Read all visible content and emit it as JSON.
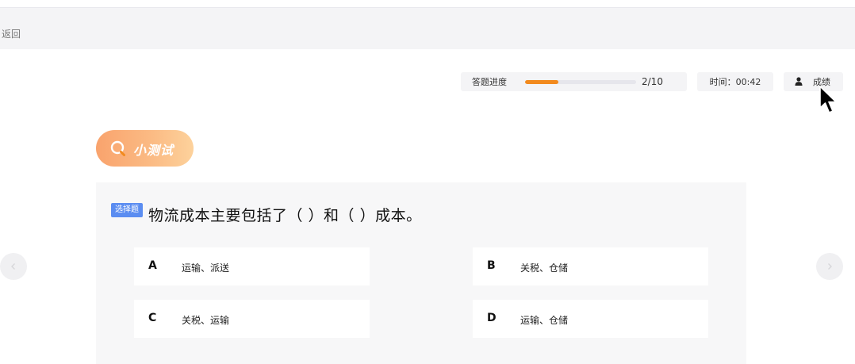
{
  "header": {
    "back_label": "返回"
  },
  "progress": {
    "label": "答题进度",
    "current": 2,
    "total": 10,
    "count_text": "2/10",
    "fraction": 0.3,
    "color": "#f28a1e"
  },
  "timer": {
    "text": "时间：00:42"
  },
  "score": {
    "label": "成绩",
    "icon": "user-icon"
  },
  "quiz": {
    "badge_label": "小测试",
    "badge_icon": "search-icon"
  },
  "question": {
    "type_label": "选择题",
    "text": "物流成本主要包括了（ ）和（ ）成本。",
    "options": [
      {
        "letter": "A",
        "text": "运输、派送"
      },
      {
        "letter": "B",
        "text": "关税、仓储"
      },
      {
        "letter": "C",
        "text": "关税、运输"
      },
      {
        "letter": "D",
        "text": "运输、仓储"
      }
    ]
  },
  "nav": {
    "prev_icon": "chevron-left-icon",
    "next_icon": "chevron-right-icon"
  },
  "colors": {
    "accent": "#f28a1e",
    "type_badge": "#5b8df1",
    "quiz_badge_start": "#f9a36d",
    "quiz_badge_end": "#fdd29c"
  }
}
